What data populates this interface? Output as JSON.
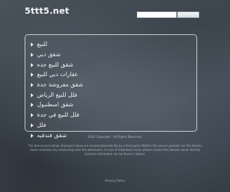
{
  "header": {
    "site_name": "5ttt5.net",
    "search_placeholder": "",
    "search_button_label": ""
  },
  "links": [
    "للبيع",
    "شقق دبي",
    "شقق للبيع جده",
    "عقارات دبي للبيع",
    "شقق مفروشة جدة",
    "فلل للبيع الرياض",
    "شقق اسطنبول",
    "فلل للبيع في جدة",
    "فلل",
    "شقق فندقيه"
  ],
  "footer": {
    "copyright": "2020 Copyright . All Rights Reserved.",
    "disclaimer": "The Sponsored Listings displayed above are served automatically by a third party. Neither the service provider nor the domain owner maintain any relationship with the advertisers. In case of trademark issues please contact the domain owner directly (contact information can be found in whois).",
    "privacy_label": "Privacy Policy"
  },
  "colors": {
    "background": "#424b54",
    "panel_border": "#e6ebf0",
    "text": "#eef1f4"
  }
}
